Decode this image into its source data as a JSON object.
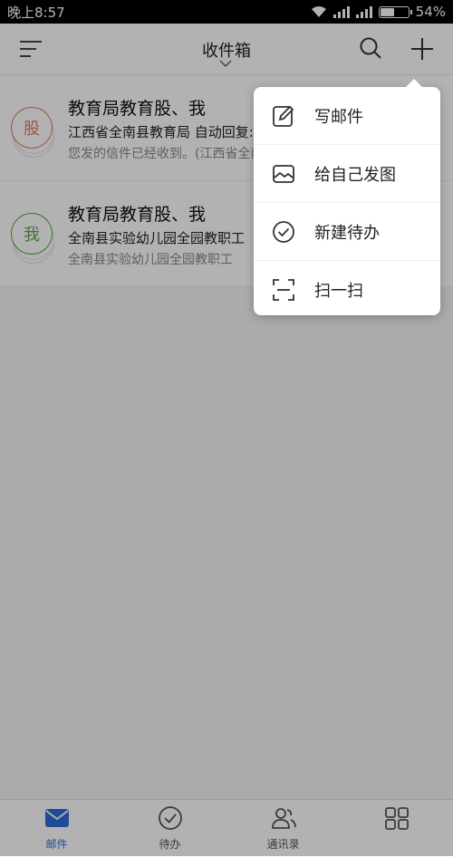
{
  "status_bar": {
    "time": "晚上8:57",
    "battery": "54%",
    "battery_level": 0.54
  },
  "header": {
    "title": "收件箱"
  },
  "mails": [
    {
      "avatar_char": "股",
      "avatar_color": "#e07a5f",
      "sender": "教育局教育股、我",
      "subject": "江西省全南县教育局 自动回复:实验幼儿园",
      "preview": "您发的信件已经收到。(江西省全南县教育局"
    },
    {
      "avatar_char": "我",
      "avatar_color": "#5aa845",
      "sender": "教育局教育股、我",
      "subject": "全南县实验幼儿园全园教职工",
      "preview": "全南县实验幼儿园全园教职工"
    }
  ],
  "popup_menu": {
    "items": [
      {
        "label": "写邮件",
        "icon": "compose-icon"
      },
      {
        "label": "给自己发图",
        "icon": "image-icon"
      },
      {
        "label": "新建待办",
        "icon": "check-circle-icon"
      },
      {
        "label": "扫一扫",
        "icon": "scan-icon"
      }
    ]
  },
  "bottom_nav": {
    "items": [
      {
        "label": "邮件",
        "icon": "mail-icon",
        "active": true
      },
      {
        "label": "待办",
        "icon": "check-circle-icon",
        "active": false
      },
      {
        "label": "通讯录",
        "icon": "contacts-icon",
        "active": false
      },
      {
        "label": "",
        "icon": "apps-icon",
        "active": false
      }
    ]
  },
  "colors": {
    "accent": "#2b6fd6"
  }
}
